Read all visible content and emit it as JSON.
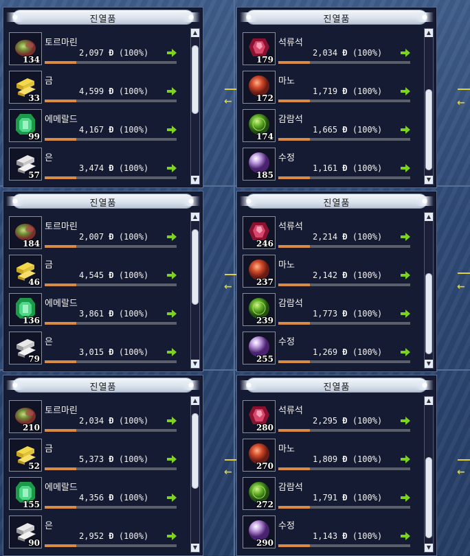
{
  "window_title": "진열품",
  "currency_symbol": "Đ",
  "icons": {
    "tourmaline": "tourmaline-gem-icon",
    "gold": "gold-bars-icon",
    "emerald": "emerald-gem-icon",
    "silver": "silver-bars-icon",
    "garnet": "garnet-gem-icon",
    "agate": "agate-gem-icon",
    "peridot": "peridot-gem-icon",
    "crystal": "crystal-orb-icon",
    "arrow": "green-arrow-icon"
  },
  "panels": [
    {
      "items": [
        {
          "name": "토르마린",
          "qty": "134",
          "price": "2,097",
          "pct": "(100%)"
        },
        {
          "name": "금",
          "qty": "33",
          "price": "4,599",
          "pct": "(100%)"
        },
        {
          "name": "에메랄드",
          "qty": "99",
          "price": "4,167",
          "pct": "(100%)"
        },
        {
          "name": "은",
          "qty": "57",
          "price": "3,474",
          "pct": "(100%)"
        }
      ]
    },
    {
      "items": [
        {
          "name": "석류석",
          "qty": "179",
          "price": "2,034",
          "pct": "(100%)"
        },
        {
          "name": "마노",
          "qty": "172",
          "price": "1,719",
          "pct": "(100%)"
        },
        {
          "name": "감람석",
          "qty": "174",
          "price": "1,665",
          "pct": "(100%)"
        },
        {
          "name": "수정",
          "qty": "185",
          "price": "1,161",
          "pct": "(100%)"
        }
      ]
    },
    {
      "items": [
        {
          "name": "토르마린",
          "qty": "184",
          "price": "2,007",
          "pct": "(100%)"
        },
        {
          "name": "금",
          "qty": "46",
          "price": "4,545",
          "pct": "(100%)"
        },
        {
          "name": "에메랄드",
          "qty": "136",
          "price": "3,861",
          "pct": "(100%)"
        },
        {
          "name": "은",
          "qty": "79",
          "price": "3,015",
          "pct": "(100%)"
        }
      ]
    },
    {
      "items": [
        {
          "name": "석류석",
          "qty": "246",
          "price": "2,214",
          "pct": "(100%)"
        },
        {
          "name": "마노",
          "qty": "237",
          "price": "2,142",
          "pct": "(100%)"
        },
        {
          "name": "감람석",
          "qty": "239",
          "price": "1,773",
          "pct": "(100%)"
        },
        {
          "name": "수정",
          "qty": "255",
          "price": "1,269",
          "pct": "(100%)"
        }
      ]
    },
    {
      "items": [
        {
          "name": "토르마린",
          "qty": "210",
          "price": "2,034",
          "pct": "(100%)"
        },
        {
          "name": "금",
          "qty": "52",
          "price": "5,373",
          "pct": "(100%)"
        },
        {
          "name": "에메랄드",
          "qty": "155",
          "price": "4,356",
          "pct": "(100%)"
        },
        {
          "name": "은",
          "qty": "90",
          "price": "2,952",
          "pct": "(100%)"
        }
      ]
    },
    {
      "items": [
        {
          "name": "석류석",
          "qty": "280",
          "price": "2,295",
          "pct": "(100%)"
        },
        {
          "name": "마노",
          "qty": "270",
          "price": "1,809",
          "pct": "(100%)"
        },
        {
          "name": "감람석",
          "qty": "272",
          "price": "1,791",
          "pct": "(100%)"
        },
        {
          "name": "수정",
          "qty": "290",
          "price": "1,143",
          "pct": "(100%)"
        }
      ]
    }
  ]
}
